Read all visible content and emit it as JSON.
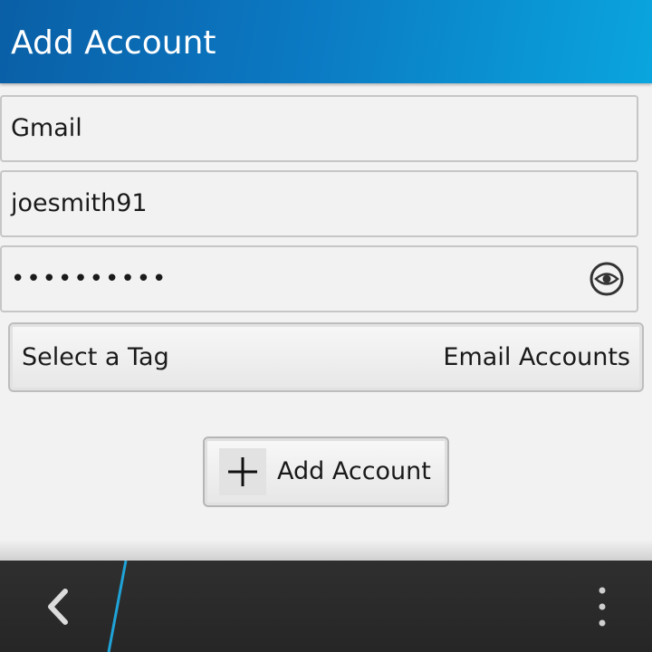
{
  "header": {
    "title": "Add Account"
  },
  "form": {
    "account_type": "Gmail",
    "username": "joesmith91",
    "password_masked": "••••••••••",
    "show_password_icon": "eye-icon"
  },
  "tag": {
    "label": "Select a Tag",
    "selected": "Email Accounts"
  },
  "add_button": {
    "label": "Add Account",
    "icon": "plus-icon"
  },
  "actionbar": {
    "back_icon": "chevron-left-icon",
    "overflow_icon": "overflow-menu-icon"
  },
  "colors": {
    "accent": "#0aa5de",
    "titlebar_dark": "#0a5fa6",
    "actionbar": "#2b2b2b",
    "divider": "#1fa3d8"
  }
}
